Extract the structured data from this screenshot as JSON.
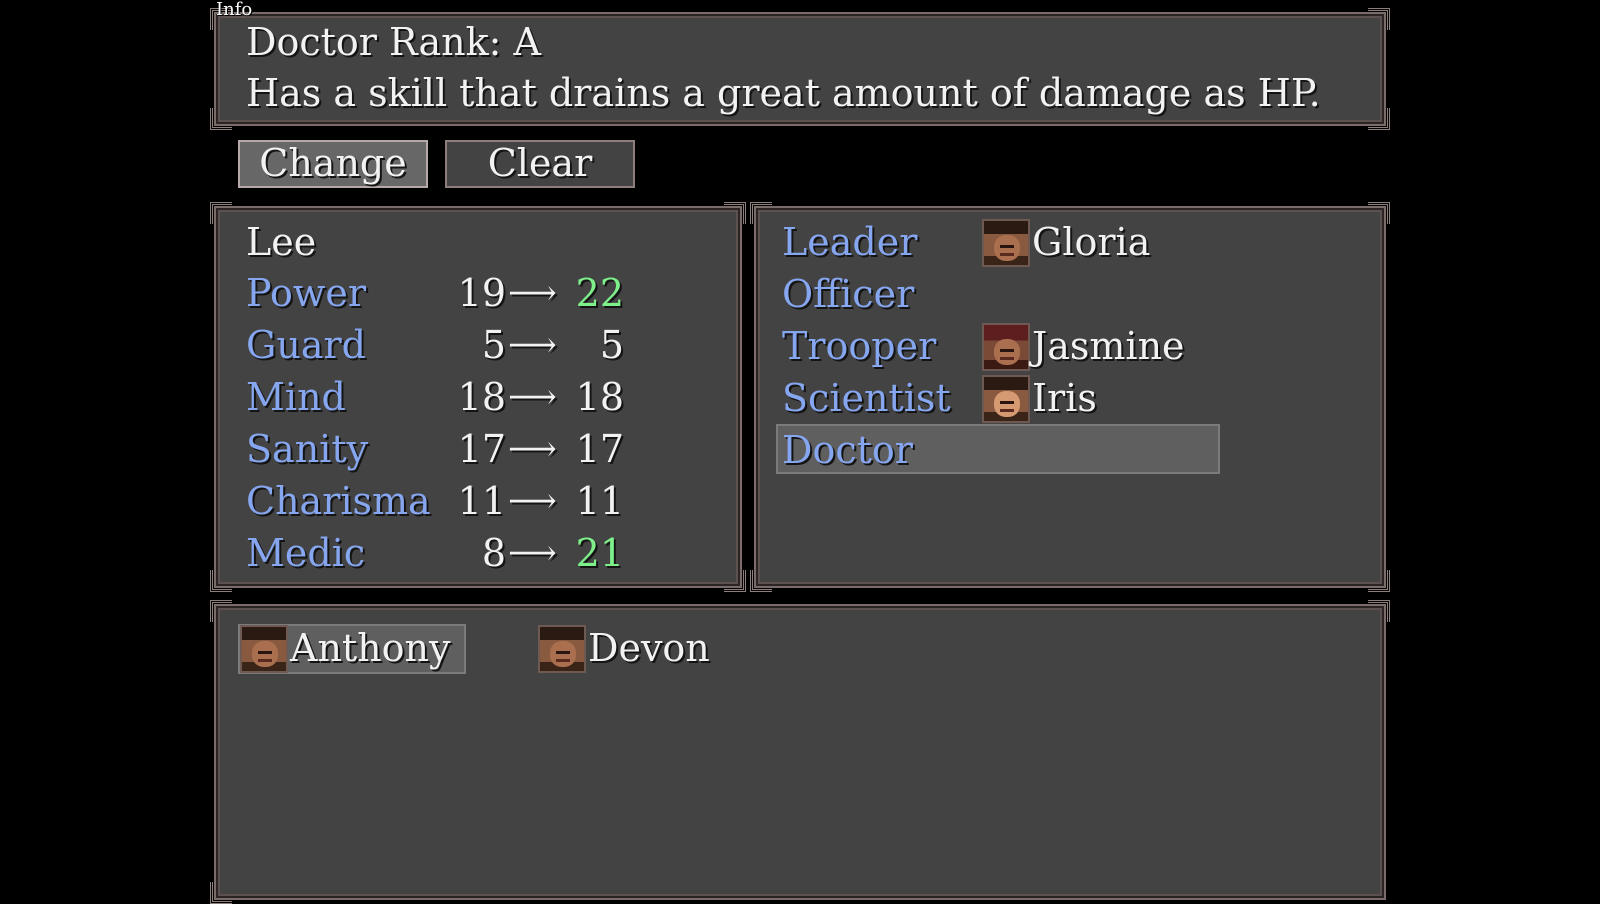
{
  "info": {
    "tag": "Info",
    "line1": "Doctor Rank: A",
    "line2": "Has a skill that drains a great amount of damage as HP."
  },
  "buttons": {
    "change": "Change",
    "clear": "Clear"
  },
  "character": {
    "name": "Lee",
    "stats": [
      {
        "label": "Power",
        "from": "19",
        "to": "22",
        "changed": true
      },
      {
        "label": "Guard",
        "from": "5",
        "to": "5",
        "changed": false
      },
      {
        "label": "Mind",
        "from": "18",
        "to": "18",
        "changed": false
      },
      {
        "label": "Sanity",
        "from": "17",
        "to": "17",
        "changed": false
      },
      {
        "label": "Charisma",
        "from": "11",
        "to": "11",
        "changed": false
      },
      {
        "label": "Medic",
        "from": "8",
        "to": "21",
        "changed": true
      }
    ],
    "arrow": "⟶"
  },
  "roles": [
    {
      "role": "Leader",
      "member": "Gloria",
      "face": "dark"
    },
    {
      "role": "Officer",
      "member": "",
      "face": ""
    },
    {
      "role": "Trooper",
      "member": "Jasmine",
      "face": "red"
    },
    {
      "role": "Scientist",
      "member": "Iris",
      "face": "light"
    },
    {
      "role": "Doctor",
      "member": "",
      "face": "",
      "selected": true
    }
  ],
  "reserve": [
    {
      "name": "Anthony",
      "selected": true
    },
    {
      "name": "Devon",
      "selected": false
    }
  ],
  "colors": {
    "label_blue": "#86a6f0",
    "increase_green": "#7df08a",
    "window_bg": "#434343"
  }
}
